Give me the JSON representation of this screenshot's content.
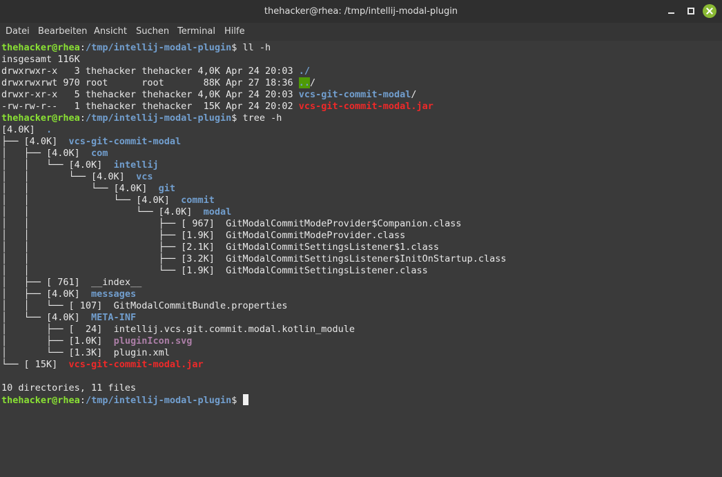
{
  "window": {
    "title": "thehacker@rhea: /tmp/intellij-modal-plugin"
  },
  "menu": [
    "Datei",
    "Bearbeiten",
    "Ansicht",
    "Suchen",
    "Terminal",
    "Hilfe"
  ],
  "prompt": {
    "user_host": "thehacker@rhea",
    "sep": ":",
    "path": "/tmp/intellij-modal-plugin",
    "symbol": "$ "
  },
  "commands": {
    "ll": "ll -h",
    "tree": "tree -h"
  },
  "ll_output": {
    "total": "insgesamt 116K",
    "rows": [
      {
        "meta": "drwxrwxr-x   3 thehacker thehacker 4,0K Apr 24 20:03 ",
        "name": "./",
        "suffix": ""
      },
      {
        "meta": "drwxrwxrwt 970 root      root       88K Apr 27 18:36 ",
        "name": "..",
        "suffix": "/"
      },
      {
        "meta": "drwxr-xr-x   5 thehacker thehacker 4,0K Apr 24 20:03 ",
        "name": "vcs-git-commit-modal",
        "suffix": "/"
      },
      {
        "meta": "-rw-rw-r--   1 thehacker thehacker  15K Apr 24 20:02 ",
        "name": "vcs-git-commit-modal.jar",
        "suffix": ""
      }
    ]
  },
  "tree_output": {
    "root": {
      "prefix": "[4.0K]  ",
      "name": "."
    },
    "entries": [
      {
        "prefix": "├── [4.0K]  ",
        "name": "vcs-git-commit-modal"
      },
      {
        "prefix": "│   ├── [4.0K]  ",
        "name": "com"
      },
      {
        "prefix": "│   │   └── [4.0K]  ",
        "name": "intellij"
      },
      {
        "prefix": "│   │       └── [4.0K]  ",
        "name": "vcs"
      },
      {
        "prefix": "│   │           └── [4.0K]  ",
        "name": "git"
      },
      {
        "prefix": "│   │               └── [4.0K]  ",
        "name": "commit"
      },
      {
        "prefix": "│   │                   └── [4.0K]  ",
        "name": "modal"
      },
      {
        "prefix": "│   │                       ├── [ 967]  ",
        "name": "GitModalCommitModeProvider$Companion.class"
      },
      {
        "prefix": "│   │                       ├── [1.9K]  ",
        "name": "GitModalCommitModeProvider.class"
      },
      {
        "prefix": "│   │                       ├── [2.1K]  ",
        "name": "GitModalCommitSettingsListener$1.class"
      },
      {
        "prefix": "│   │                       ├── [3.2K]  ",
        "name": "GitModalCommitSettingsListener$InitOnStartup.class"
      },
      {
        "prefix": "│   │                       └── [1.9K]  ",
        "name": "GitModalCommitSettingsListener.class"
      },
      {
        "prefix": "│   ├── [ 761]  ",
        "name": "__index__"
      },
      {
        "prefix": "│   ├── [4.0K]  ",
        "name": "messages"
      },
      {
        "prefix": "│   │   └── [ 107]  ",
        "name": "GitModalCommitBundle.properties"
      },
      {
        "prefix": "│   └── [4.0K]  ",
        "name": "META-INF"
      },
      {
        "prefix": "│       ├── [  24]  ",
        "name": "intellij.vcs.git.commit.modal.kotlin_module"
      },
      {
        "prefix": "│       ├── [1.0K]  ",
        "name": "pluginIcon.svg"
      },
      {
        "prefix": "│       └── [1.3K]  ",
        "name": "plugin.xml"
      },
      {
        "prefix": "└── [ 15K]  ",
        "name": "vcs-git-commit-modal.jar"
      }
    ],
    "summary": "10 directories, 11 files"
  },
  "colors": {
    "prompt_user": "#8ae234",
    "prompt_path": "#729fcf",
    "directory": "#729fcf",
    "archive": "#ef2929",
    "image": "#ad7fa8",
    "close_button": "#8ab934"
  }
}
